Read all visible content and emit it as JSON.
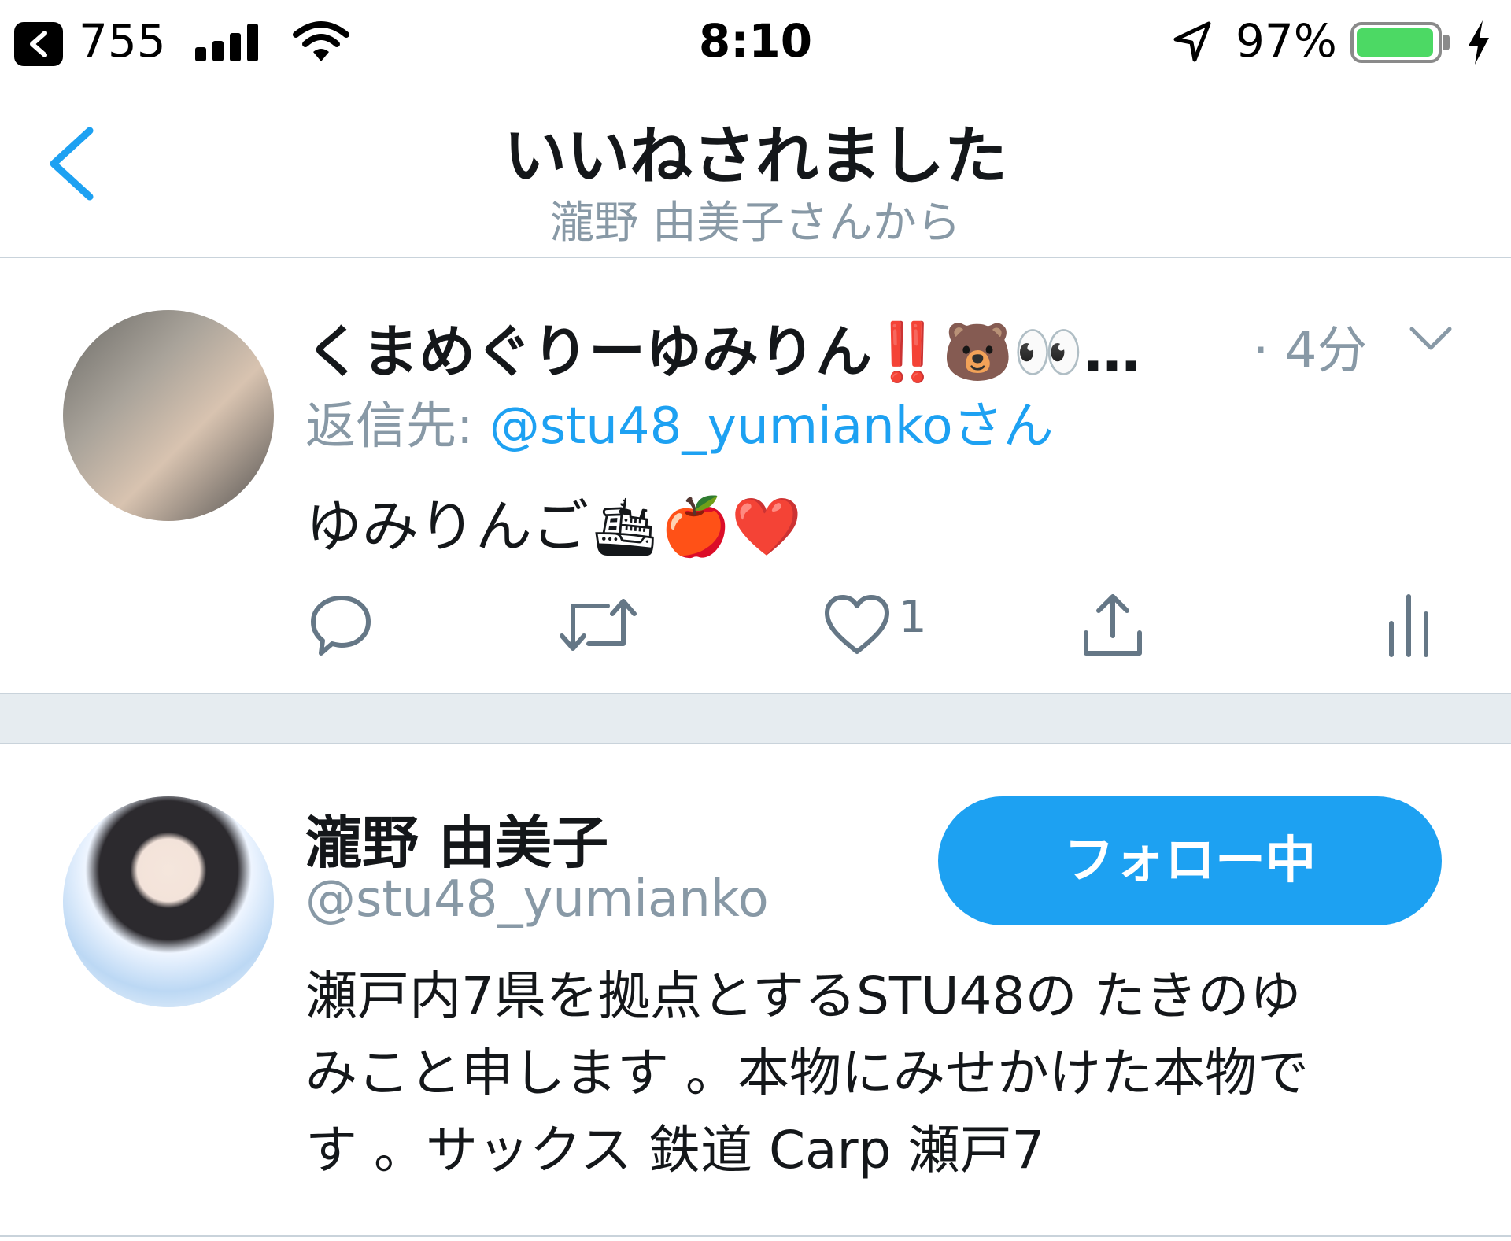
{
  "status_bar": {
    "carrier": "755",
    "time": "8:10",
    "battery_percent_label": "97%",
    "battery_level": 0.97
  },
  "nav": {
    "title": "いいねされました",
    "subtitle": "瀧野 由美子さんから"
  },
  "tweet": {
    "display_name": "くまめぐりーゆみりん‼️🐻👀…",
    "time": "· 4分",
    "reply_prefix": "返信先: ",
    "reply_mention": "@stu48_yumiankoさん",
    "text": "ゆみりんご🛳🍎❤️",
    "like_count": "1"
  },
  "user_card": {
    "name": "瀧野 由美子",
    "handle": "@stu48_yumianko",
    "follow_label": "フォロー中",
    "bio_lines": [
      "瀬戸内7県を拠点とするSTU48の たきのゆ",
      "みこと申します 。本物にみせかけた本物で",
      "す 。サックス 鉄道 Carp 瀬戸7"
    ]
  },
  "colors": {
    "accent": "#1da1f2",
    "secondary_text": "#8899a6",
    "battery_green": "#4cd964"
  }
}
